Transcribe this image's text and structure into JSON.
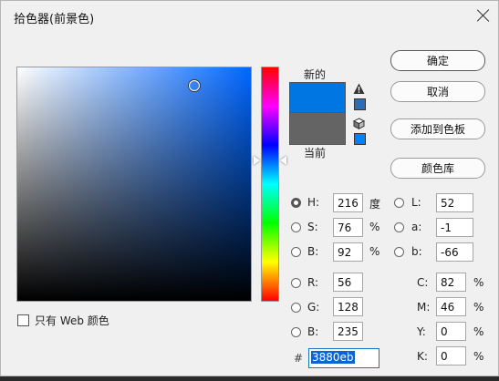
{
  "title": "拾色器(前景色)",
  "preview": {
    "new_label": "新的",
    "current_label": "当前",
    "new_color": "#0076e3",
    "current_color": "#646464"
  },
  "buttons": {
    "ok": "确定",
    "cancel": "取消",
    "add_swatch": "添加到色板",
    "libraries": "颜色库"
  },
  "hsb": {
    "h_label": "H:",
    "h": "216",
    "h_unit": "度",
    "s_label": "S:",
    "s": "76",
    "s_unit": "%",
    "b_label": "B:",
    "b": "92",
    "b_unit": "%"
  },
  "lab": {
    "l_label": "L:",
    "l": "52",
    "a_label": "a:",
    "a": "-1",
    "b_label": "b:",
    "b": "-66"
  },
  "rgb": {
    "r_label": "R:",
    "r": "56",
    "g_label": "G:",
    "g": "128",
    "b_label": "B:",
    "b": "235"
  },
  "cmyk": {
    "c_label": "C:",
    "c": "82",
    "m_label": "M:",
    "m": "46",
    "y_label": "Y:",
    "y": "0",
    "k_label": "K:",
    "k": "0",
    "unit": "%"
  },
  "hex": {
    "label": "#",
    "value": "3880eb"
  },
  "web_only": {
    "label": "只有 Web 颜色",
    "checked": false
  },
  "icons": [
    "close-icon",
    "warning-icon",
    "cube-icon"
  ]
}
